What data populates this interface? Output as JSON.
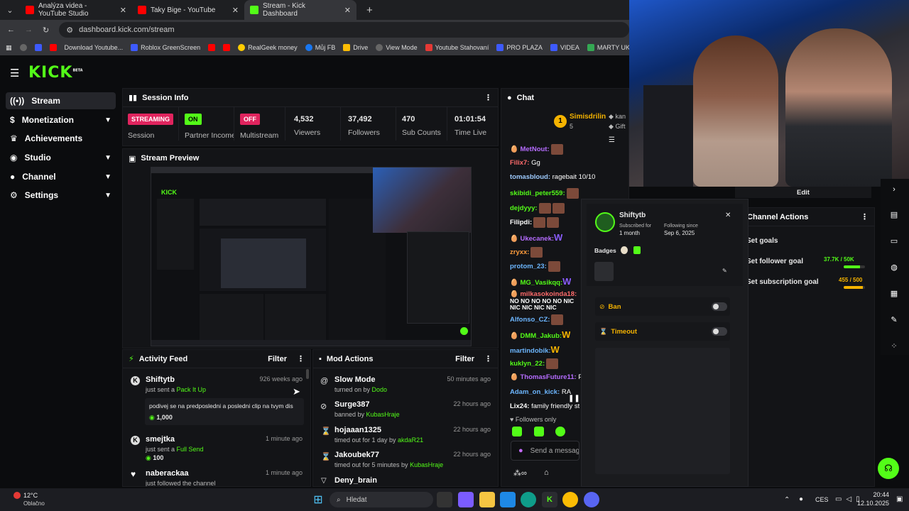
{
  "browser": {
    "tabs": [
      {
        "label": "Analýza videa - YouTube Studio",
        "color": "#ff0000"
      },
      {
        "label": "Taky Bige - YouTube",
        "color": "#ff0000"
      },
      {
        "label": "Stream - Kick Dashboard",
        "color": "#53fc18"
      }
    ],
    "url": "dashboard.kick.com/stream",
    "bookmarks": [
      "Download Youtube...",
      "Roblox GreenScreen",
      "RealGeek money",
      "Můj FB",
      "Drive",
      "View Mode",
      "Youtube Stahovaní",
      "PRO PLAZA",
      "VIDEA",
      "MARTY UKOLY"
    ]
  },
  "logo": "KICK",
  "logo_sup": "BETA",
  "sidebar": [
    {
      "label": "Stream",
      "icon": "radio-icon"
    },
    {
      "label": "Monetization",
      "icon": "dollar-icon",
      "chevron": true
    },
    {
      "label": "Achievements",
      "icon": "trophy-icon"
    },
    {
      "label": "Studio",
      "icon": "studio-icon",
      "chevron": true
    },
    {
      "label": "Channel",
      "icon": "channel-icon",
      "chevron": true
    },
    {
      "label": "Settings",
      "icon": "gear-icon",
      "chevron": true
    }
  ],
  "session": {
    "title": "Session Info",
    "streaming": "STREAMING",
    "session_label": "Session",
    "partner_badge": "ON",
    "partner_label": "Partner Income",
    "multi_badge": "OFF",
    "multi_label": "Multistream",
    "viewers": "4,532",
    "viewers_label": "Viewers",
    "followers": "37,492",
    "followers_label": "Followers",
    "subs": "470",
    "subs_label": "Sub Counts",
    "time": "01:01:54",
    "time_label": "Time Live"
  },
  "preview_title": "Stream Preview",
  "activity": {
    "title": "Activity Feed",
    "filter": "Filter",
    "items": [
      {
        "name": "Shiftytb",
        "action": "just sent a ",
        "item": "Pack It Up",
        "time": "926 weeks ago",
        "message": "podivej se na predposledni a posledni clip na tvym dis",
        "amount": "1,000"
      },
      {
        "name": "smejtka",
        "action": "just sent a ",
        "item": "Full Send",
        "time": "1 minute ago",
        "amount": "100"
      },
      {
        "name": "naberackaa",
        "action": "just followed the channel",
        "time": "1 minute ago"
      }
    ]
  },
  "mod": {
    "title": "Mod Actions",
    "filter": "Filter",
    "items": [
      {
        "name": "Slow Mode",
        "action": "turned on by ",
        "by": "Dodo",
        "time": "50 minutes ago"
      },
      {
        "name": "Surge387",
        "action": "banned by ",
        "by": "KubasHraje",
        "time": "22 hours ago"
      },
      {
        "name": "hojaaan1325",
        "action": "timed out for 1 day by ",
        "by": "akdaR21",
        "time": "22 hours ago"
      },
      {
        "name": "Jakoubek77",
        "action": "timed out for 5 minutes by ",
        "by": "KubasHraje",
        "time": "22 hours ago"
      },
      {
        "name": "Deny_brain",
        "action": "",
        "by": "",
        "time": ""
      }
    ]
  },
  "chat": {
    "title": "Chat",
    "top_gifter": "Simisdrilin",
    "top_gifter_count": "5",
    "next_gifter": "kan",
    "gift_label": "Gift",
    "lines": [
      {
        "user": "MetNout:",
        "text": "",
        "color": "#b56cff"
      },
      {
        "user": "Filix7:",
        "text": " Gg",
        "color": "#ff6b6b"
      },
      {
        "user": "tomasbloud:",
        "text": " ragebait 10/10",
        "color": "#9ecbff"
      },
      {
        "user": "skibidi_peter559:",
        "text": "",
        "color": "#53fc18"
      },
      {
        "user": "dejdyyy:",
        "text": "",
        "color": "#53fc18"
      },
      {
        "user": "Filipdi:",
        "text": "",
        "color": "#ffffff"
      },
      {
        "user": "Ukecanek:",
        "text": "",
        "color": "#b56cff"
      },
      {
        "user": "zryxx:",
        "text": "",
        "color": "#ff9d3c"
      },
      {
        "user": "protom_23:",
        "text": "",
        "color": "#6cb6ff"
      },
      {
        "user": "MG_Vasikqq:",
        "text": "",
        "color": "#53fc18"
      },
      {
        "user": "milkasokoinda18:",
        "text": "",
        "color": "#ff6b6b"
      },
      {
        "user": "Alfonso_CZ:",
        "text": "",
        "color": "#6cb6ff"
      },
      {
        "user": "DMM_Jakub:",
        "text": "",
        "color": "#53fc18"
      },
      {
        "user": "martindobik:",
        "text": "",
        "color": "#6cb6ff"
      },
      {
        "user": "kuklyn_22:",
        "text": "",
        "color": "#53fc18"
      },
      {
        "user": "ThomasFuture11:",
        "text": " Po",
        "color": "#b56cff"
      },
      {
        "user": "Adam_on_kick:",
        "text": " RA",
        "color": "#6cb6ff"
      },
      {
        "user": "Lix24:",
        "text": " family friendly st",
        "color": "#ffffff"
      }
    ],
    "followers_only": "Followers only",
    "send_placeholder": "Send a message"
  },
  "popup": {
    "username": "Shiftytb",
    "subscribed_label": "Subscribed for",
    "subscribed_value": "1 month",
    "following_label": "Following since",
    "following_value": "Sep 6, 2025",
    "badges_label": "Badges",
    "ban_label": "Ban",
    "timeout_label": "Timeout"
  },
  "channel_actions": {
    "edit": "Edit",
    "title": "Channel Actions",
    "goals": "Set goals",
    "follower_goal": "Set follower goal",
    "follower_value": "37.7K / 50K",
    "follower_progress": 0.754,
    "sub_goal": "Set subscription goal",
    "sub_value": "455 / 500",
    "sub_progress": 0.91
  },
  "taskbar": {
    "weather_temp": "12°C",
    "weather_desc": "Oblačno",
    "search": "Hledat",
    "lang": "CES",
    "time": "20:44",
    "date": "12.10.2025"
  }
}
